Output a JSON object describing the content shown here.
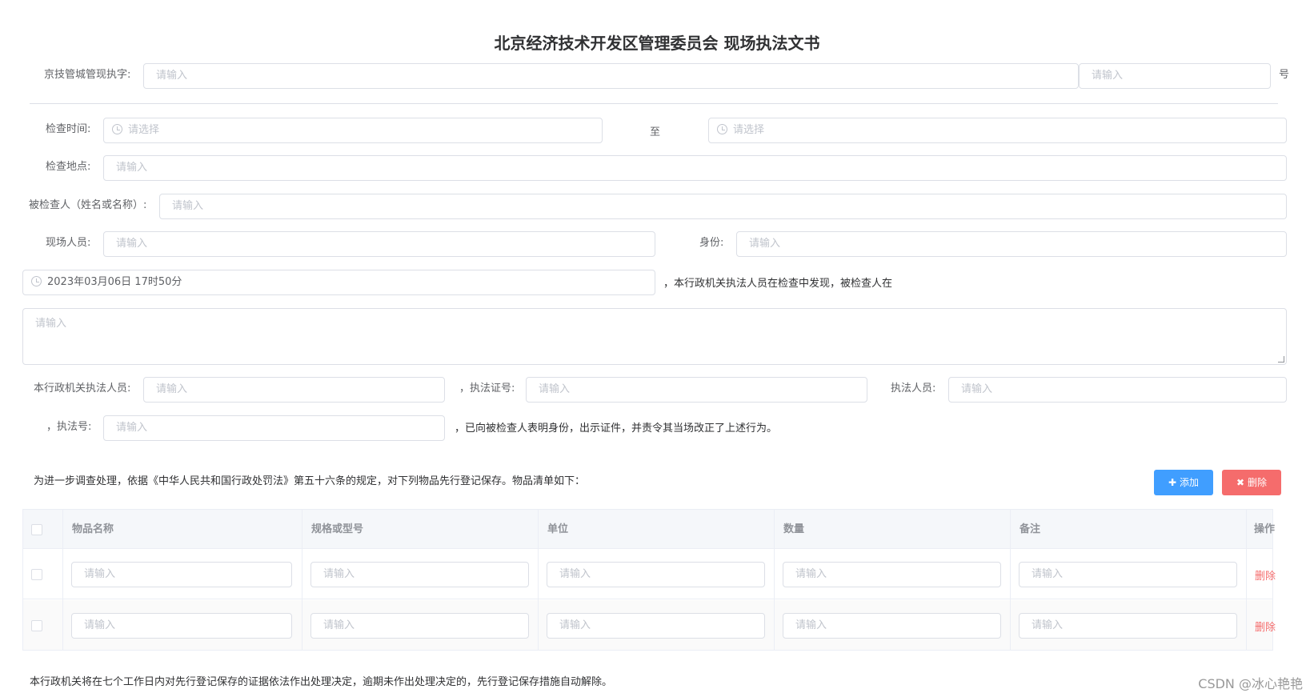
{
  "title": "北京经济技术开发区管理委员会  现场执法文书",
  "header_row": {
    "label": "京技管城管现执字:",
    "placeholder": "请输入",
    "suffix": "号"
  },
  "form": {
    "inspect_time_label": "检查时间:",
    "time_select_placeholder": "请选择",
    "to_label": "至",
    "location_label": "检查地点:",
    "inspected_label": "被检查人（姓名或名称）:",
    "onsite_label": "现场人员:",
    "identity_label": "身份:",
    "datetime_value": "2023年03月06日 17时50分",
    "found_text": "，本行政机关执法人员在检查中发现，被检查人在",
    "officer_label": "本行政机关执法人员:",
    "cert_label": "，执法证号:",
    "officer2_label": "执法人员:",
    "lawno_label": "，执法号:",
    "shown_text": "，已向被检查人表明身份，出示证件，并责令其当场改正了上述行为。",
    "input_placeholder": "请输入"
  },
  "items_section": {
    "intro": "为进一步调查处理，依据《中华人民共和国行政处罚法》第五十六条的规定，对下列物品先行登记保存。物品清单如下：",
    "add_label": "添加",
    "delete_label": "删除"
  },
  "table": {
    "headers": [
      "物品名称",
      "规格或型号",
      "单位",
      "数量",
      "备注",
      "操作"
    ],
    "rows": [
      {
        "placeholder": "请输入",
        "action": "删除"
      },
      {
        "placeholder": "请输入",
        "action": "删除"
      }
    ]
  },
  "footer_text": "本行政机关将在七个工作日内对先行登记保存的证据依法作出处理决定，逾期未作出处理决定的，先行登记保存措施自动解除。",
  "watermark": "CSDN @冰心艳艳",
  "colors": {
    "primary": "#409eff",
    "danger": "#f56c6c",
    "border": "#dcdfe6"
  }
}
